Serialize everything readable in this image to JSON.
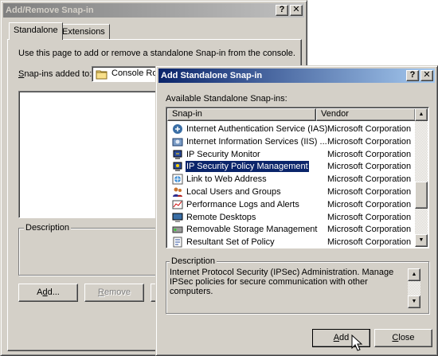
{
  "main_window": {
    "title": "Add/Remove Snap-in",
    "help_btn": "?",
    "close_btn": "✕",
    "tabs": [
      {
        "label": "Standalone"
      },
      {
        "label": "Extensions"
      }
    ],
    "instructions": "Use this page to add or remove a standalone Snap-in from the console.",
    "snapins_label_u": "S",
    "snapins_label_rest": "nap-ins added to:",
    "snapins_value": "Console Root",
    "description_label": "Description",
    "add_u_pre": "A",
    "add_u": "d",
    "add_post": "d...",
    "remove_u": "R",
    "remove_post": "emove"
  },
  "dialog": {
    "title": "Add Standalone Snap-in",
    "help_btn": "?",
    "close_btn": "✕",
    "available_label": "Available Standalone Snap-ins:",
    "columns": {
      "snapin": "Snap-in",
      "vendor": "Vendor"
    },
    "rows": [
      {
        "name": "Internet Authentication Service (IAS)",
        "vendor": "Microsoft Corporation",
        "icon": "ias-icon",
        "selected": false
      },
      {
        "name": "Internet Information Services (IIS) ...",
        "vendor": "Microsoft Corporation",
        "icon": "iis-icon",
        "selected": false
      },
      {
        "name": "IP Security Monitor",
        "vendor": "Microsoft Corporation",
        "icon": "ip-monitor-icon",
        "selected": false
      },
      {
        "name": "IP Security Policy Management",
        "vendor": "Microsoft Corporation",
        "icon": "ip-policy-icon",
        "selected": true
      },
      {
        "name": "Link to Web Address",
        "vendor": "Microsoft Corporation",
        "icon": "web-link-icon",
        "selected": false
      },
      {
        "name": "Local Users and Groups",
        "vendor": "Microsoft Corporation",
        "icon": "users-icon",
        "selected": false
      },
      {
        "name": "Performance Logs and Alerts",
        "vendor": "Microsoft Corporation",
        "icon": "perf-logs-icon",
        "selected": false
      },
      {
        "name": "Remote Desktops",
        "vendor": "Microsoft Corporation",
        "icon": "remote-desktop-icon",
        "selected": false
      },
      {
        "name": "Removable Storage Management",
        "vendor": "Microsoft Corporation",
        "icon": "removable-storage-icon",
        "selected": false
      },
      {
        "name": "Resultant Set of Policy",
        "vendor": "Microsoft Corporation",
        "icon": "rsop-icon",
        "selected": false
      }
    ],
    "description_label": "Description",
    "description_text": "Internet Protocol Security (IPSec) Administration. Manage IPSec policies for secure communication with other computers.",
    "add_u": "A",
    "add_rest": "dd",
    "close_label_u": "C",
    "close_label_rest": "lose"
  }
}
